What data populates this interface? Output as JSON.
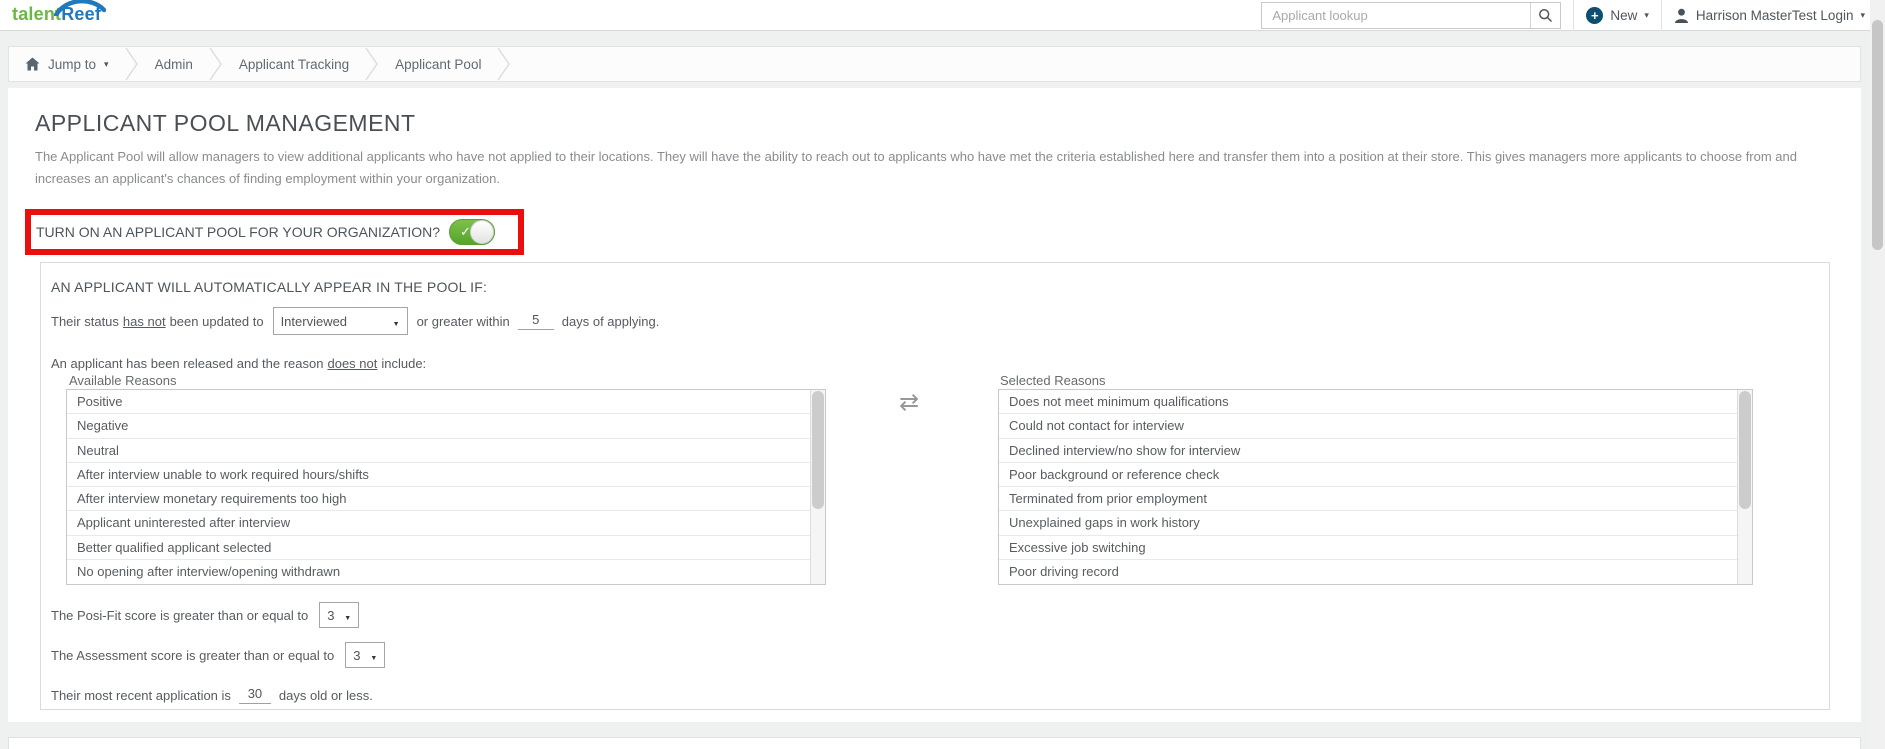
{
  "header": {
    "logo_talent": "talent",
    "logo_reef": "Reef",
    "search_placeholder": "Applicant lookup",
    "new_label": "New",
    "user_label": "Harrison MasterTest Login"
  },
  "breadcrumb": {
    "jump_to": "Jump to",
    "items": [
      "Admin",
      "Applicant Tracking",
      "Applicant Pool"
    ]
  },
  "page": {
    "title": "APPLICANT POOL MANAGEMENT",
    "description": "The Applicant Pool will allow managers to view additional applicants who have not applied to their locations. They will have the ability to reach out to applicants who have met the criteria established here and transfer them into a position at their store. This gives managers more applicants to choose from and increases an applicant's chances of finding employment within your organization.",
    "toggle_label": "TURN ON AN APPLICANT POOL FOR YOUR ORGANIZATION?",
    "toggle_state": "on"
  },
  "criteria": {
    "heading": "AN APPLICANT WILL AUTOMATICALLY APPEAR IN THE POOL IF:",
    "status_rule": {
      "text_before": "Their status",
      "text_underlined": "has not",
      "text_after_underline": "been updated to",
      "status_value": "Interviewed",
      "text_after_select": "or greater within",
      "days_value": "5",
      "text_end": "days of applying."
    },
    "released_rule": {
      "text_before": "An applicant has been released and the reason",
      "text_underlined": "does not",
      "text_end": "include:"
    },
    "available_reasons": {
      "label": "Available Reasons",
      "items": [
        "Positive",
        "Negative",
        "Neutral",
        "After interview unable to work required hours/shifts",
        "After interview monetary requirements too high",
        "Applicant uninterested after interview",
        "Better qualified applicant selected",
        "No opening after interview/opening withdrawn"
      ]
    },
    "selected_reasons": {
      "label": "Selected Reasons",
      "items": [
        "Does not meet minimum qualifications",
        "Could not contact for interview",
        "Declined interview/no show for interview",
        "Poor background or reference check",
        "Terminated from prior employment",
        "Unexplained gaps in work history",
        "Excessive job switching",
        "Poor driving record"
      ]
    },
    "posifit_rule": {
      "text": "The Posi-Fit score is greater than or equal to",
      "value": "3"
    },
    "assessment_rule": {
      "text": "The Assessment score is greater than or equal to",
      "value": "3"
    },
    "recent_rule": {
      "text_before": "Their most recent application is",
      "value": "30",
      "text_end": "days old or less."
    }
  },
  "colors": {
    "logo_green": "#6cb644",
    "logo_blue": "#2079bc",
    "toggle_green": "#5fae32",
    "annotation_red": "#ea0f0c",
    "underline_blue": "#7ca9d8",
    "new_icon_blue": "#0d4e71",
    "page_background": "#eff0f0"
  }
}
